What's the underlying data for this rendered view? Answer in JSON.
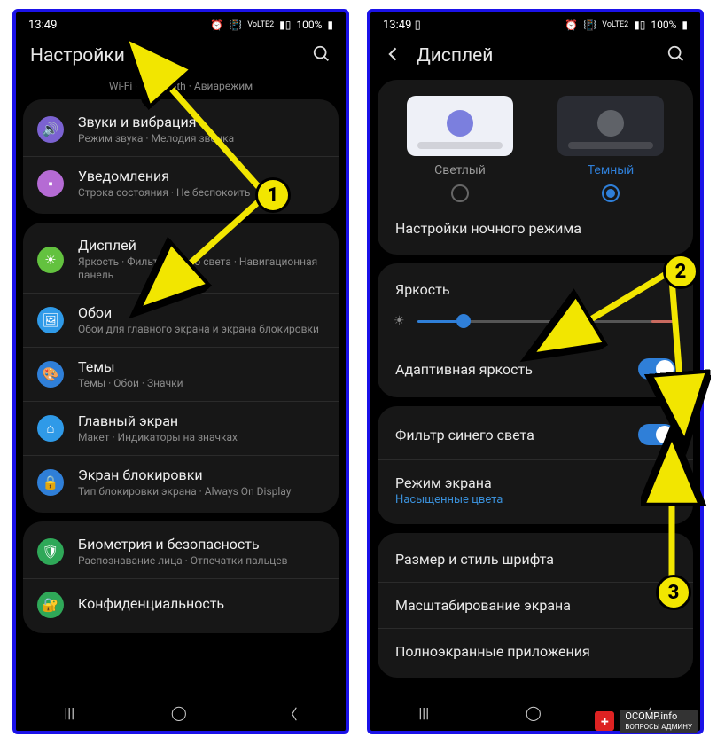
{
  "statusbar": {
    "time": "13:49",
    "battery": "100%",
    "net": "VoLTE2"
  },
  "screen1": {
    "title": "Настройки",
    "tagline": "Wi-Fi  ·  Bluetooth  ·  Авиарежим",
    "rows": [
      {
        "title": "Звуки и вибрация",
        "sub": "Режим звука · Мелодия звонка"
      },
      {
        "title": "Уведомления",
        "sub": "Строка состояния · Не беспокоить"
      },
      {
        "title": "Дисплей",
        "sub": "Яркость · Фильтр синего света · Навигационная панель"
      },
      {
        "title": "Обои",
        "sub": "Обои для главного экрана и экрана блокировки"
      },
      {
        "title": "Темы",
        "sub": "Темы · Обои · Значки"
      },
      {
        "title": "Главный экран",
        "sub": "Макет · Индикаторы на значках"
      },
      {
        "title": "Экран блокировки",
        "sub": "Тип блокировки экрана · Always On Display"
      },
      {
        "title": "Биометрия и безопасность",
        "sub": "Распознавание лица · Отпечатки пальцев"
      },
      {
        "title": "Конфиденциальность",
        "sub": ""
      }
    ]
  },
  "screen2": {
    "title": "Дисплей",
    "theme": {
      "light": "Светлый",
      "dark": "Темный"
    },
    "night": "Настройки ночного режима",
    "brightness": "Яркость",
    "adaptive": "Адаптивная яркость",
    "bluefilter": "Фильтр синего света",
    "screenmode": {
      "title": "Режим экрана",
      "sub": "Насыщенные цвета"
    },
    "font": "Размер и стиль шрифта",
    "zoom": "Масштабирование экрана",
    "fullscreen": "Полноэкранные приложения"
  },
  "annotations": {
    "b1": "1",
    "b2": "2",
    "b3": "3"
  },
  "watermark": {
    "site": "OCOMP.info",
    "sub": "ВОПРОСЫ АДМИНУ"
  }
}
